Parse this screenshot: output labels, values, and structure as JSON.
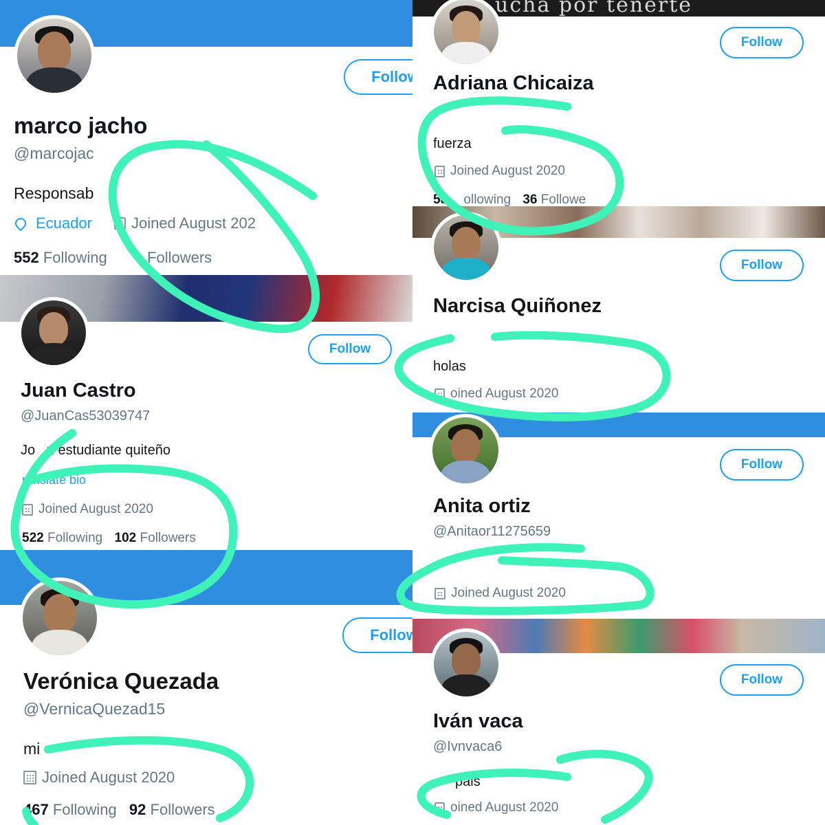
{
  "accent_color": "#1da1f2",
  "scribble_color": "#3ff2b8",
  "profiles": {
    "marco": {
      "name": "marco jacho",
      "handle": "@marcojac",
      "bio": "Responsab",
      "location": "Ecuador",
      "joined": "Joined August 202",
      "following_count": "552",
      "following_label": "Following",
      "followers_label": "Followers",
      "follow_label": "Follow",
      "icons": [
        "location-pin-icon",
        "calendar-icon"
      ]
    },
    "juan": {
      "name": "Juan Castro",
      "handle": "@JuanCas53039747",
      "bio": "Jo   n estudiante quiteño",
      "translate": "ranslate bio",
      "joined": "Joined August 2020",
      "following_count": "522",
      "following_label": "Following",
      "followers_count": "102",
      "followers_label": "Followers",
      "follow_label": "Follow"
    },
    "veronica": {
      "name": "Verónica Quezada",
      "handle": "@VernicaQuezad15",
      "bio": "mi",
      "joined": "Joined August 2020",
      "following_count": "467",
      "following_label": "Following",
      "followers_count": "92",
      "followers_label": "Followers",
      "follow_label": "Follow"
    },
    "adriana": {
      "name": "Adriana Chicaiza",
      "bio": "fuerza",
      "joined": "Joined August 2020",
      "following_count": "58",
      "following_label": "ollowing",
      "followers_count": "36",
      "followers_label": "Followe",
      "follow_label": "Follow",
      "banner_text": "ucha por tenerte"
    },
    "narcisa": {
      "name": "Narcisa Quiñonez",
      "bio": "holas",
      "joined": "oined August 2020",
      "follow_label": "Follow"
    },
    "anita": {
      "name": "Anita ortiz",
      "handle": "@Anitaor11275659",
      "joined": "Joined August 2020",
      "follow_label": "Follow"
    },
    "ivan": {
      "name": "Iván vaca",
      "handle": "@Ivnvaca6",
      "bio": "pais",
      "joined": "oined August 2020",
      "follow_label": "Follow"
    }
  }
}
